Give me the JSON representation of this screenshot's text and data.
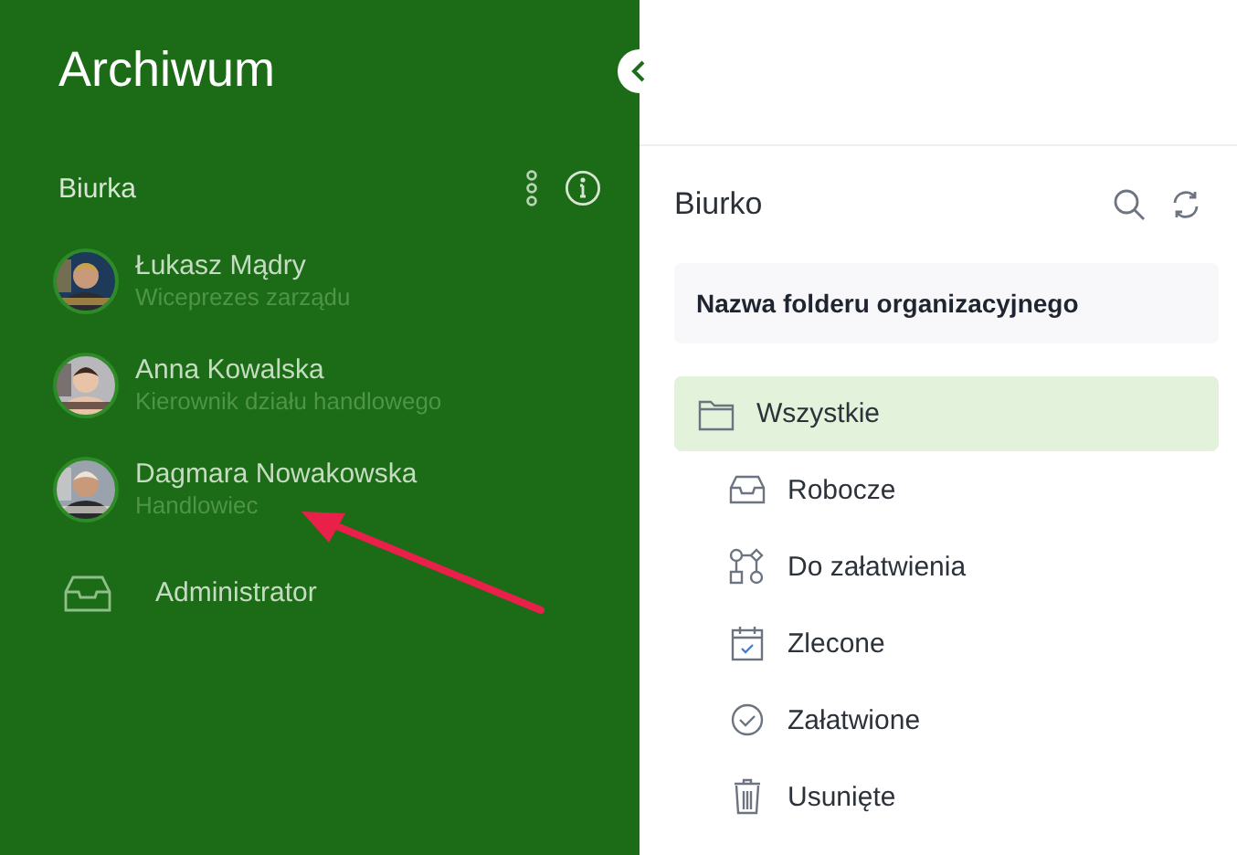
{
  "sidebar": {
    "title": "Archiwum",
    "section_label": "Biurka",
    "desks": [
      {
        "kind": "person",
        "name": "Łukasz Mądry",
        "role": "Wiceprezes zarządu"
      },
      {
        "kind": "person",
        "name": "Anna Kowalska",
        "role": "Kierownik działu handlowego"
      },
      {
        "kind": "person",
        "name": "Dagmara Nowakowska",
        "role": "Handlowiec"
      },
      {
        "kind": "inbox",
        "name": "Administrator"
      }
    ]
  },
  "desk_panel": {
    "title": "Biurko",
    "folder_name": "Nazwa folderu organizacyjnego",
    "folders": [
      {
        "kind": "folder",
        "label": "Wszystkie",
        "selected": true,
        "children": [
          {
            "kind": "inbox",
            "label": "Robocze",
            "selected": false
          },
          {
            "kind": "workflow",
            "label": "Do załatwienia",
            "selected": false
          },
          {
            "kind": "calendar",
            "label": "Zlecone",
            "selected": false
          },
          {
            "kind": "check",
            "label": "Załatwione",
            "selected": false
          },
          {
            "kind": "trash",
            "label": "Usunięte",
            "selected": false
          }
        ]
      }
    ]
  }
}
